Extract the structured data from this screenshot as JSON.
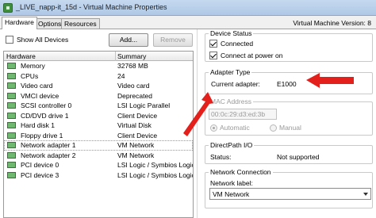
{
  "window": {
    "title": "_LIVE_napp-it_15d - Virtual Machine Properties",
    "vm_version_label": "Virtual Machine Version: 8"
  },
  "tabs": [
    "Hardware",
    "Options",
    "Resources"
  ],
  "hardware": {
    "show_all_devices_label": "Show All Devices",
    "show_all_devices_checked": false,
    "add_label": "Add...",
    "remove_label": "Remove",
    "columns": [
      "Hardware",
      "Summary"
    ],
    "rows": [
      {
        "name": "Memory",
        "summary": "32768 MB",
        "icon": "memory-icon"
      },
      {
        "name": "CPUs",
        "summary": "24",
        "icon": "cpu-icon"
      },
      {
        "name": "Video card",
        "summary": "Video card",
        "icon": "video-card-icon"
      },
      {
        "name": "VMCI device",
        "summary": "Deprecated",
        "icon": "vmci-device-icon"
      },
      {
        "name": "SCSI controller 0",
        "summary": "LSI Logic Parallel",
        "icon": "scsi-controller-icon"
      },
      {
        "name": "CD/DVD drive 1",
        "summary": "Client Device",
        "icon": "cd-dvd-drive-icon"
      },
      {
        "name": "Hard disk 1",
        "summary": "Virtual Disk",
        "icon": "hard-disk-icon"
      },
      {
        "name": "Floppy drive 1",
        "summary": "Client Device",
        "icon": "floppy-drive-icon"
      },
      {
        "name": "Network adapter 1",
        "summary": "VM Network",
        "icon": "network-adapter-icon",
        "selected": true
      },
      {
        "name": "Network adapter 2",
        "summary": "VM Network",
        "icon": "network-adapter-icon"
      },
      {
        "name": "PCI device 0",
        "summary": "LSI Logic / Symbios Logic",
        "icon": "pci-device-icon"
      },
      {
        "name": "PCI device 3",
        "summary": "LSI Logic / Symbios Logic",
        "icon": "pci-device-icon"
      }
    ]
  },
  "device_status": {
    "title": "Device Status",
    "connected_label": "Connected",
    "connected_checked": true,
    "connect_at_power_on_label": "Connect at power on",
    "connect_at_power_on_checked": true
  },
  "adapter_type": {
    "title": "Adapter Type",
    "current_adapter_label": "Current adapter:",
    "current_adapter_value": "E1000"
  },
  "mac_address": {
    "title": "MAC Address",
    "value": "00:0c:29:d3:ed:3b",
    "automatic_label": "Automatic",
    "manual_label": "Manual",
    "automatic_selected": true
  },
  "directpath": {
    "title": "DirectPath I/O",
    "status_label": "Status:",
    "status_value": "Not supported"
  },
  "network_connection": {
    "title": "Network Connection",
    "network_label": "Network label:",
    "selected_network": "VM Network"
  },
  "colors": {
    "arrow_red": "#e3201b",
    "titlebar": "#c5d9ef"
  }
}
